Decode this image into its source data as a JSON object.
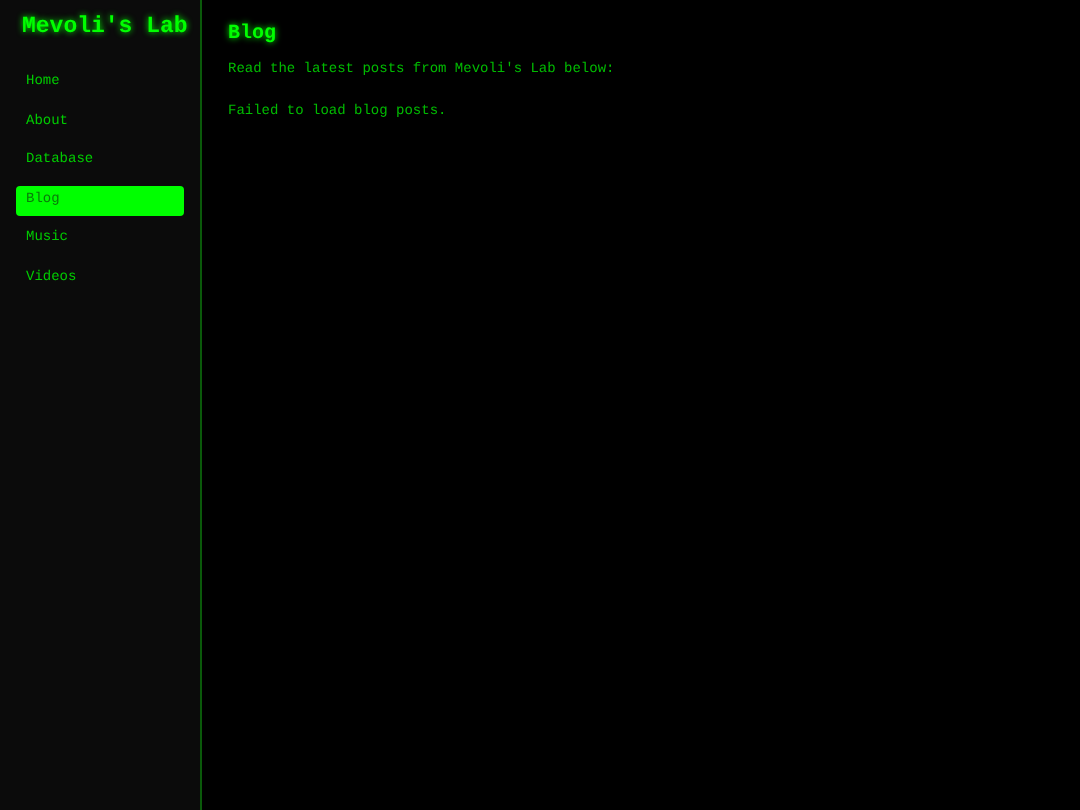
{
  "sidebar": {
    "title": "Mevoli's Lab",
    "items": [
      {
        "label": "Home",
        "selected": false
      },
      {
        "label": "About",
        "selected": false
      },
      {
        "label": "Database",
        "selected": false
      },
      {
        "label": "Blog",
        "selected": true
      },
      {
        "label": "Music",
        "selected": false
      },
      {
        "label": "Videos",
        "selected": false
      }
    ]
  },
  "main": {
    "heading": "Blog",
    "intro": "Read the latest posts from Mevoli's Lab below:",
    "error": "Failed to load blog posts."
  }
}
